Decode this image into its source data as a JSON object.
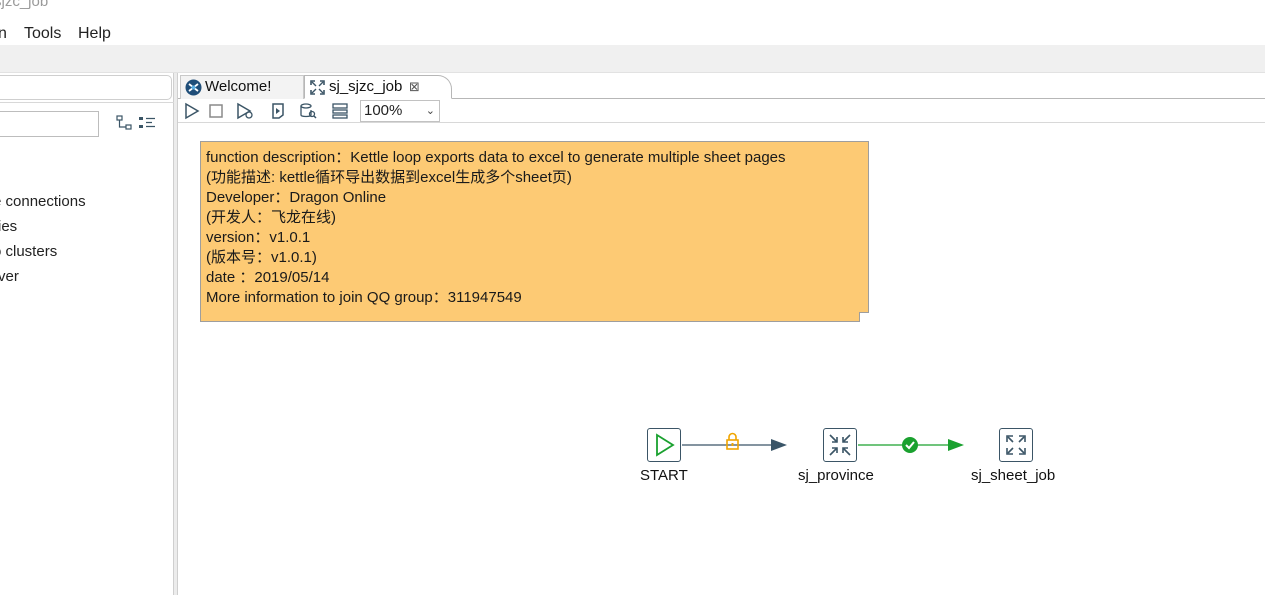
{
  "window": {
    "title": "sjzc_job"
  },
  "menu": {
    "items": [
      "n",
      "Tools",
      "Help"
    ]
  },
  "left_panel": {
    "tree": [
      "e connections",
      "ries",
      "o clusters",
      "rver"
    ]
  },
  "tabs": [
    {
      "label": "Welcome!",
      "icon": "welcome-icon"
    },
    {
      "label": "sj_sjzc_job",
      "icon": "job-icon",
      "close": "⊠"
    }
  ],
  "canvas_toolbar": {
    "zoom": "100%",
    "icons": [
      "run-icon",
      "stop-icon",
      "run-options-icon",
      "debug-icon",
      "preview-icon",
      "layout-icon"
    ]
  },
  "note": {
    "lines": [
      "function description：Kettle loop exports data to excel to generate multiple sheet pages",
      "(功能描述: kettle循环导出数据到excel生成多个sheet页)",
      "Developer：Dragon Online",
      "(开发人：飞龙在线)",
      "version：v1.0.1",
      "(版本号：v1.0.1)",
      "date ：2019/05/14",
      "More information to join QQ group：311947549"
    ]
  },
  "job": {
    "entries": [
      {
        "label": "START",
        "icon": "start-icon"
      },
      {
        "label": "sj_province",
        "icon": "job-entry-icon"
      },
      {
        "label": "sj_sheet_job",
        "icon": "job-entry-icon"
      }
    ],
    "hops": [
      {
        "from": "START",
        "to": "sj_province",
        "type": "unconditional",
        "color": "#3a5568",
        "icon": "lock-icon"
      },
      {
        "from": "sj_province",
        "to": "sj_sheet_job",
        "type": "success",
        "color": "#1aa12f",
        "icon": "check-icon"
      }
    ]
  },
  "colors": {
    "note_bg": "#fdca74",
    "hop_success": "#1aa12f",
    "hop_unconditional": "#3a5568",
    "lock": "#f0a500"
  }
}
